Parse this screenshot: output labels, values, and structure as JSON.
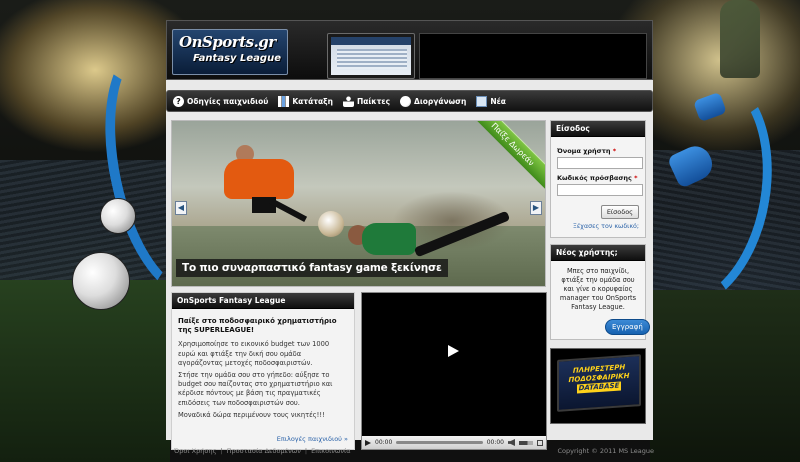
{
  "header": {
    "logo_line1": "OnSports.gr",
    "logo_line2": "Fantasy League"
  },
  "menu": [
    {
      "label": "Οδηγίες παιχνιδιού",
      "icon": "help-icon"
    },
    {
      "label": "Κατάταξη",
      "icon": "ranking-icon"
    },
    {
      "label": "Παίκτες",
      "icon": "players-icon"
    },
    {
      "label": "Διοργάνωση",
      "icon": "soccer-ball-icon"
    },
    {
      "label": "Νέα",
      "icon": "news-icon"
    }
  ],
  "slider": {
    "caption": "Το πιο συναρπαστικό fantasy game ξεκίνησε",
    "ribbon": "Παίξε Δωρεάν",
    "prev": "◀",
    "next": "▶"
  },
  "about": {
    "title": "OnSports Fantasy League",
    "heading": "Παίξε στο ποδοσφαιρικό χρηματιστήριο της SUPERLEAGUE!",
    "p1": "Χρησιμοποίησε το εικονικό budget των 1000 ευρώ και φτιάξε την δική σου ομάδα αγοράζοντας μετοχές ποδοσφαιριστών.",
    "p2": "Στήσε την ομάδα σου στο γήπεδο: αύξησε το budget σου παίζοντας στο χρηματιστήριο και κέρδισε πόντους με βάση τις πραγματικές επιδόσεις των ποδοσφαιριστών σου.",
    "p3": "Μοναδικά δώρα περιμένουν τους νικητές!!!",
    "more": "Επιλογές παιχνιδιού »"
  },
  "video": {
    "time_current": "00:00",
    "time_total": "00:00",
    "volume": 0.6
  },
  "login": {
    "title": "Είσοδος",
    "username_label": "Όνομα χρήστη",
    "password_label": "Κωδικός πρόσβασης",
    "required_mark": "*",
    "username_value": "",
    "password_value": "",
    "submit": "Είσοδος",
    "forgot": "Ξέχασες τον κωδικό;"
  },
  "newuser": {
    "title": "Νέος χρήστης;",
    "text": "Μπες στο παιχνίδι, φτιάξε την ομάδα σου και γίνε ο κορυφαίος manager του OnSports Fantasy League.",
    "button": "Εγγραφή"
  },
  "promo": {
    "line1": "ΠΛΗΡΕΣΤΕΡΗ",
    "line2": "ΠΟΔΟΣΦΑΙΡΙΚΗ",
    "line3": "DATABASE"
  },
  "footer": {
    "links": [
      "Όροι Χρήσης",
      "Προστασία Δεδομένων",
      "Επικοινωνία"
    ],
    "separator": "|",
    "copyright": "Copyright © 2011 MS League"
  },
  "colors": {
    "accent": "#1f79c8",
    "ribbon": "#5aa52a",
    "register_button": "#2475c4",
    "link": "#2a62a8"
  }
}
